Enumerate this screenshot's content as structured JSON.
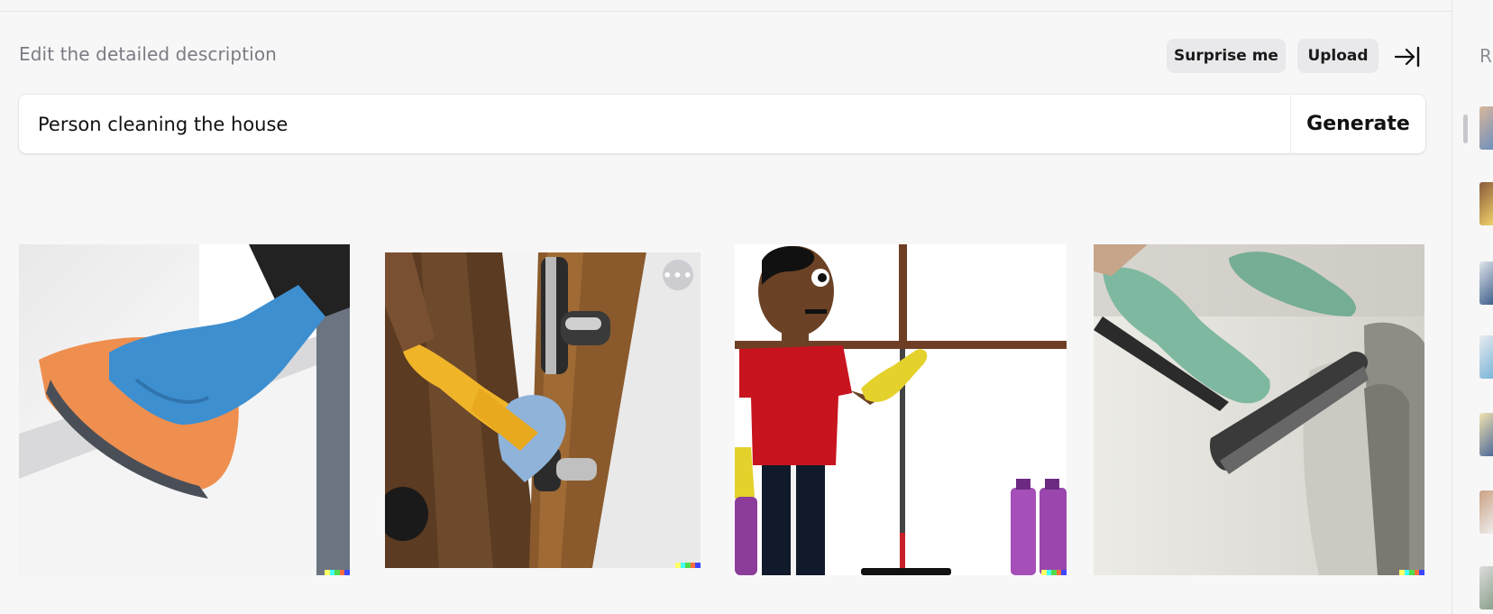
{
  "header": {
    "title": "Edit the detailed description",
    "surprise_label": "Surprise me",
    "upload_label": "Upload",
    "collapse_icon": "collapse-right-icon"
  },
  "prompt": {
    "value": "Person cleaning the house",
    "generate_label": "Generate"
  },
  "results": [
    {
      "description": "blue gloved hand wiping surface with orange cloth"
    },
    {
      "description": "yellow gloved hand cleaning door handle with blue cloth"
    },
    {
      "description": "cartoon man in red shirt with yellow gloves holding mop"
    },
    {
      "description": "green gloved hands using brush on sofa"
    }
  ],
  "watermark_colors": [
    "#ffff66",
    "#42ffff",
    "#51da4c",
    "#ff6e3c",
    "#3c46ff"
  ],
  "right_panel": {
    "header_fragment": "R"
  },
  "colors": {
    "background": "#f7f7f8",
    "pill_button": "#e9e9ec",
    "heading_text": "#7b7b84"
  }
}
